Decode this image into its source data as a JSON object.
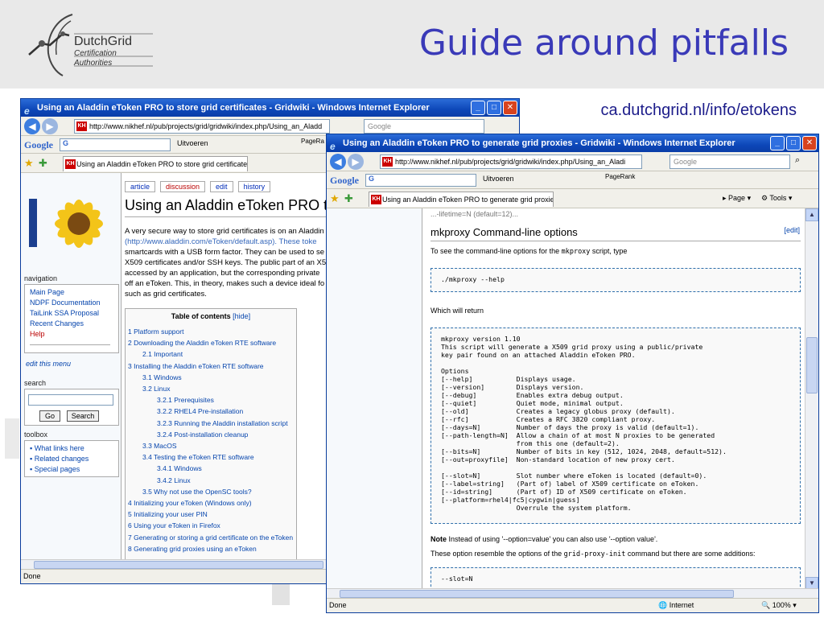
{
  "slide": {
    "title": "Guide around pitfalls",
    "url_caption": "ca.dutchgrid.nl/info/etokens",
    "logo": {
      "line1": "DutchGrid",
      "line2": "Certification",
      "line3": "Authorities"
    }
  },
  "colors": {
    "title": "#3a3ab8",
    "header_band": "#e9e9e9",
    "xp_titlebar": "#0d47b8"
  },
  "window1": {
    "title": "Using an Aladdin eToken PRO to store grid certificates - Gridwiki - Windows Internet Explorer",
    "address": "http://www.nikhef.nl/pub/projects/grid/gridwiki/index.php/Using_an_Aladd",
    "search_placeholder": "Google",
    "google_label": "G",
    "uitvoeren": "Uitvoeren",
    "pagerank": "PageRa",
    "tab_label": "Using an Aladdin eToken PRO to store grid certificates...",
    "status": "Done",
    "sidebar": {
      "navigation_label": "navigation",
      "nav_items": [
        "Main Page",
        "NDPF Documentation",
        "TaiLink SSA Proposal",
        "Recent Changes",
        "Help"
      ],
      "edit_menu": "edit this menu",
      "search_label": "search",
      "go_button": "Go",
      "search_button": "Search",
      "toolbox_label": "toolbox",
      "toolbox_items": [
        "What links here",
        "Related changes",
        "Special pages"
      ]
    },
    "article_tabs": [
      "article",
      "discussion",
      "edit",
      "history"
    ],
    "article_title": "Using an Aladdin eToken PRO to",
    "paragraph": [
      "A very secure way to store grid certificates is on an Aladdin",
      "(http://www.aladdin.com/eToken/default.asp). These toke",
      "smartcards with a USB form factor. They can be used to se",
      "X509 certificates and/or SSH keys. The public part of an X5",
      "accessed by an application, but the corresponding private",
      "off an eToken. This, in theory, makes such a device ideal fo",
      "such as grid certificates."
    ],
    "toc": {
      "title": "Table of contents",
      "hide": "[hide]",
      "items": [
        {
          "text": "1 Platform support",
          "level": 0
        },
        {
          "text": "2 Downloading the Aladdin eToken RTE software",
          "level": 0
        },
        {
          "text": "2.1 Important",
          "level": 1
        },
        {
          "text": "3 Installing the Aladdin eToken RTE software",
          "level": 0
        },
        {
          "text": "3.1 Windows",
          "level": 1
        },
        {
          "text": "3.2 Linux",
          "level": 1
        },
        {
          "text": "3.2.1 Prerequisites",
          "level": 2
        },
        {
          "text": "3.2.2 RHEL4 Pre-installation",
          "level": 2
        },
        {
          "text": "3.2.3 Running the Aladdin installation script",
          "level": 2
        },
        {
          "text": "3.2.4 Post-installation cleanup",
          "level": 2
        },
        {
          "text": "3.3 MacOS",
          "level": 1
        },
        {
          "text": "3.4 Testing the eToken RTE software",
          "level": 1
        },
        {
          "text": "3.4.1 Windows",
          "level": 2
        },
        {
          "text": "3.4.2 Linux",
          "level": 2
        },
        {
          "text": "3.5 Why not use the OpenSC tools?",
          "level": 1
        },
        {
          "text": "4 Initializing your eToken (Windows only)",
          "level": 0
        },
        {
          "text": "5 Initializing your user PIN",
          "level": 0
        },
        {
          "text": "6 Using your eToken in Firefox",
          "level": 0
        },
        {
          "text": "7 Generating or storing a grid certificate on the eToken",
          "level": 0
        },
        {
          "text": "8 Generating grid proxies using an eToken",
          "level": 0
        }
      ]
    }
  },
  "window2": {
    "title": "Using an Aladdin eToken PRO to generate grid proxies - Gridwiki - Windows Internet Explorer",
    "address": "http://www.nikhef.nl/pub/projects/grid/gridwiki/index.php/Using_an_Aladi",
    "search_placeholder": "Google",
    "google_label": "G",
    "uitvoeren": "Uitvoeren",
    "pagerank": "PageRank",
    "tab_label": "Using an Aladdin eToken PRO to generate grid proxie...",
    "page_menu": "Page",
    "tools_menu": "Tools",
    "cut_line": "...-lifetime=N (default=12)...",
    "section_heading": "mkproxy Command-line options",
    "edit_link": "[edit]",
    "intro_pre": "To see the command-line options for the ",
    "intro_code": "mkproxy",
    "intro_post": " script, type",
    "command": "./mkproxy --help",
    "which_will_return": "Which will return",
    "help_output": [
      "mkproxy version 1.10",
      "This script will generate a X509 grid proxy using a public/private",
      "key pair found on an attached Aladdin eToken PRO.",
      "",
      "Options",
      "[--help]           Displays usage.",
      "[--version]        Displays version.",
      "[--debug]          Enables extra debug output.",
      "[--quiet]          Quiet mode, minimal output.",
      "[--old]            Creates a legacy globus proxy (default).",
      "[--rfc]            Creates a RFC 3820 compliant proxy.",
      "[--days=N]         Number of days the proxy is valid (default=1).",
      "[--path-length=N]  Allow a chain of at most N proxies to be generated",
      "                   from this one (default=2).",
      "[--bits=N]         Number of bits in key (512, 1024, 2048, default=512).",
      "[--out=proxyfile]  Non-standard location of new proxy cert.",
      "",
      "[--slot=N]         Slot number where eToken is located (default=0).",
      "[--label=string]   (Part of) label of X509 certificate on eToken.",
      "[--id=string]      (Part of) ID of X509 certificate on eToken.",
      "[--platform=rhel4|fc5|cygwin|guess]",
      "                   Overrule the system platform."
    ],
    "note_bold": "Note",
    "note_text": " Instead of using '--option=value' you can also use '--option value'.",
    "these_pre": "These option resemble the options of the ",
    "these_code": "grid-proxy-init",
    "these_post": " command but there are some additions:",
    "partial_code": "--slot=N",
    "status": "Done",
    "zone": "Internet",
    "zoom": "100%"
  }
}
